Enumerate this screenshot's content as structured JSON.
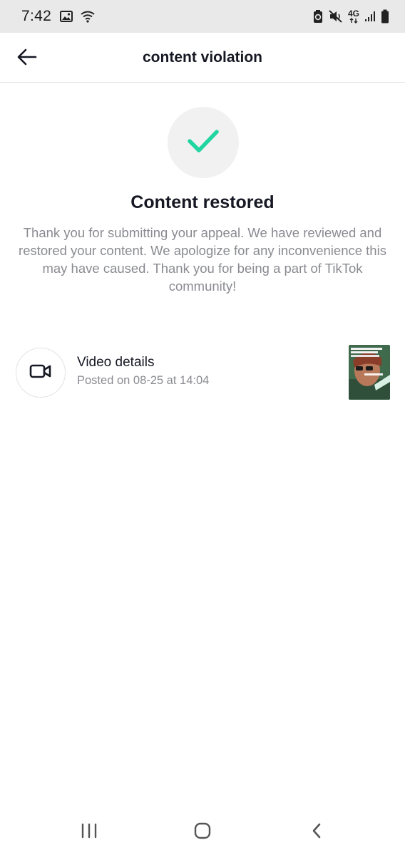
{
  "status_bar": {
    "time": "7:42",
    "network": "4G",
    "left_icons": [
      "image-icon",
      "wifi-icon"
    ],
    "right_icons": [
      "data-saver-icon",
      "mute-icon",
      "network-4g-icon",
      "signal-icon",
      "battery-icon"
    ]
  },
  "header": {
    "title": "content violation",
    "back_icon": "arrow-left-icon"
  },
  "result": {
    "icon": "checkmark-icon",
    "title": "Content restored",
    "message": "Thank you for submitting your appeal. We have reviewed and restored your content. We apologize for any inconvenience this may have caused. Thank you for being a part of TikTok community!"
  },
  "video": {
    "icon": "video-camera-icon",
    "title": "Video details",
    "posted": "Posted on 08-25 at 14:04",
    "thumbnail": "video-thumbnail"
  },
  "nav": {
    "recents_icon": "recents-icon",
    "home_icon": "home-icon",
    "back_icon": "back-chevron-icon"
  },
  "colors": {
    "accent": "#20d5a0",
    "title": "#161823",
    "secondary_text": "#8a8b91",
    "status_bar_bg": "#e9e9ea"
  }
}
